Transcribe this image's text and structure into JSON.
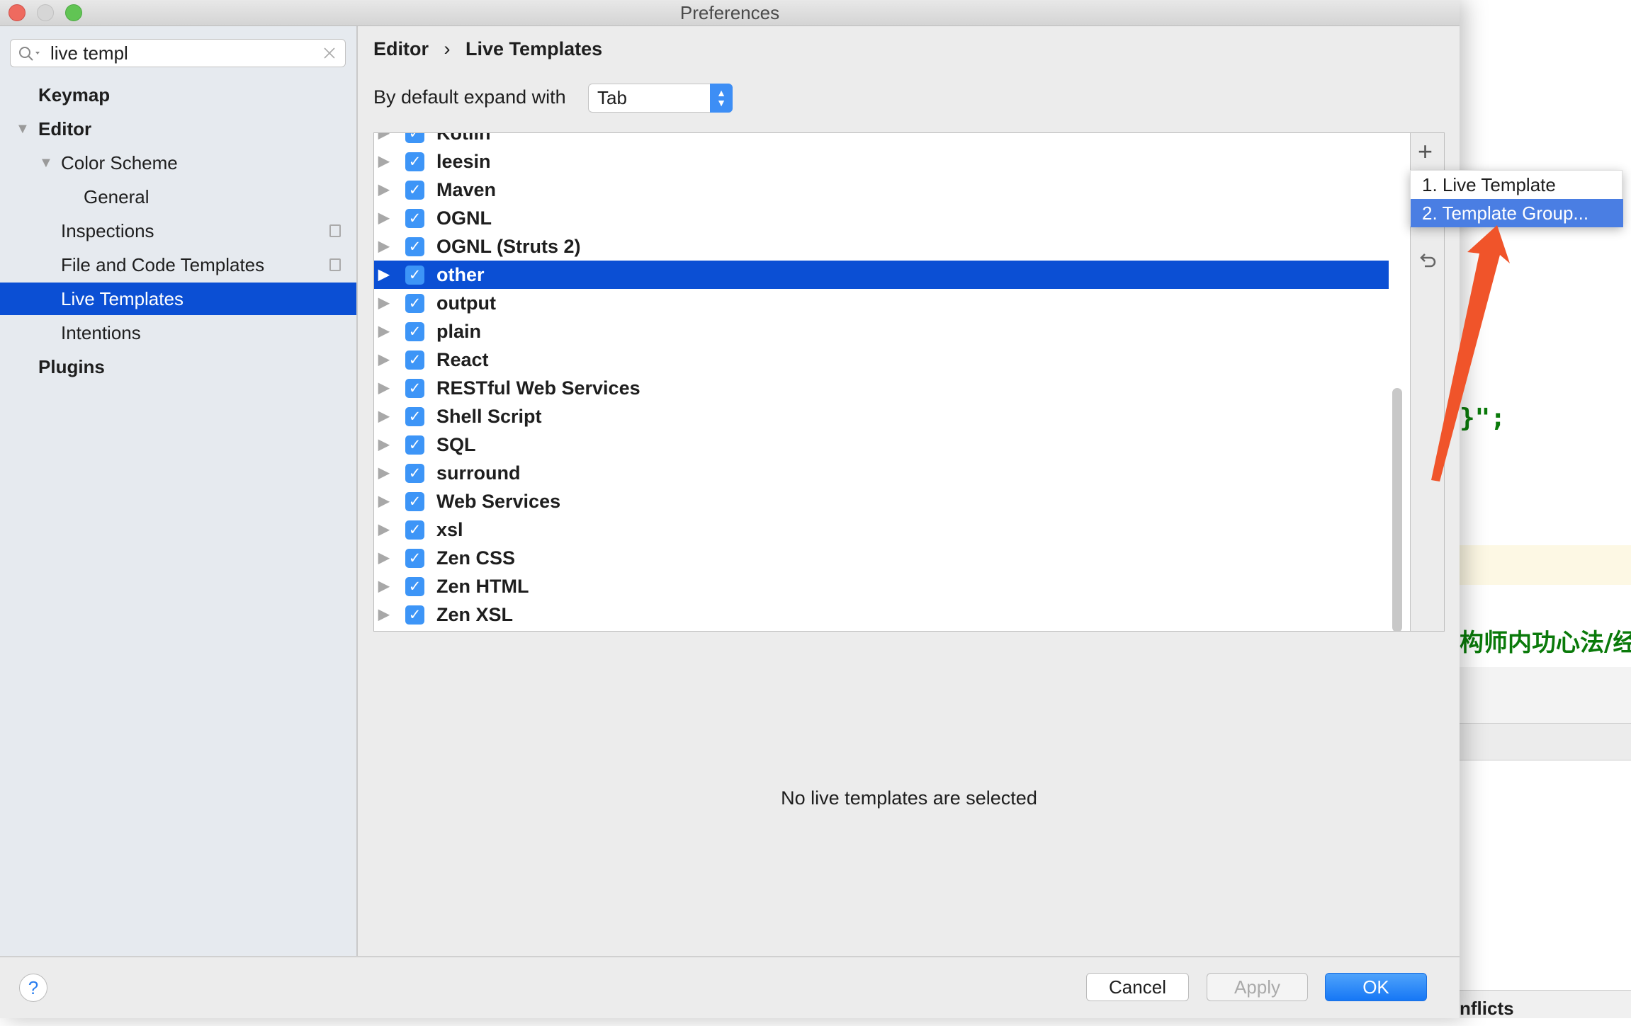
{
  "window": {
    "title": "Preferences"
  },
  "search": {
    "value": "live templ",
    "placeholder": ""
  },
  "sidebar": {
    "items": [
      {
        "label": "Keymap"
      },
      {
        "label": "Editor"
      },
      {
        "label": "Color Scheme"
      },
      {
        "label": "General"
      },
      {
        "label": "Inspections"
      },
      {
        "label": "File and Code Templates"
      },
      {
        "label": "Live Templates"
      },
      {
        "label": "Intentions"
      },
      {
        "label": "Plugins"
      }
    ]
  },
  "breadcrumb": {
    "parent": "Editor",
    "separator": "›",
    "current": "Live Templates"
  },
  "expand": {
    "label": "By default expand with",
    "value": "Tab"
  },
  "templates": [
    {
      "label": "Kotlin",
      "checked": true
    },
    {
      "label": "leesin",
      "checked": true
    },
    {
      "label": "Maven",
      "checked": true
    },
    {
      "label": "OGNL",
      "checked": true
    },
    {
      "label": "OGNL (Struts 2)",
      "checked": true
    },
    {
      "label": "other",
      "checked": true,
      "selected": true
    },
    {
      "label": "output",
      "checked": true
    },
    {
      "label": "plain",
      "checked": true
    },
    {
      "label": "React",
      "checked": true
    },
    {
      "label": "RESTful Web Services",
      "checked": true
    },
    {
      "label": "Shell Script",
      "checked": true
    },
    {
      "label": "SQL",
      "checked": true
    },
    {
      "label": "surround",
      "checked": true
    },
    {
      "label": "Web Services",
      "checked": true
    },
    {
      "label": "xsl",
      "checked": true
    },
    {
      "label": "Zen CSS",
      "checked": true
    },
    {
      "label": "Zen HTML",
      "checked": true
    },
    {
      "label": "Zen XSL",
      "checked": true
    }
  ],
  "popup": {
    "items": [
      {
        "label": "1. Live Template"
      },
      {
        "label": "2. Template Group..."
      }
    ]
  },
  "detail": {
    "empty_text": "No live templates are selected"
  },
  "buttons": {
    "help": "?",
    "cancel": "Cancel",
    "apply": "Apply",
    "ok": "OK"
  },
  "editor": {
    "code1": "}\";",
    "code2": "构师内功心法/经",
    "bottom": "nflicts"
  },
  "colors": {
    "accent": "#0b4fd4",
    "checkbox": "#3d95f7",
    "popup_selected": "#4a7ee3",
    "annotation_arrow": "#f0542a"
  }
}
